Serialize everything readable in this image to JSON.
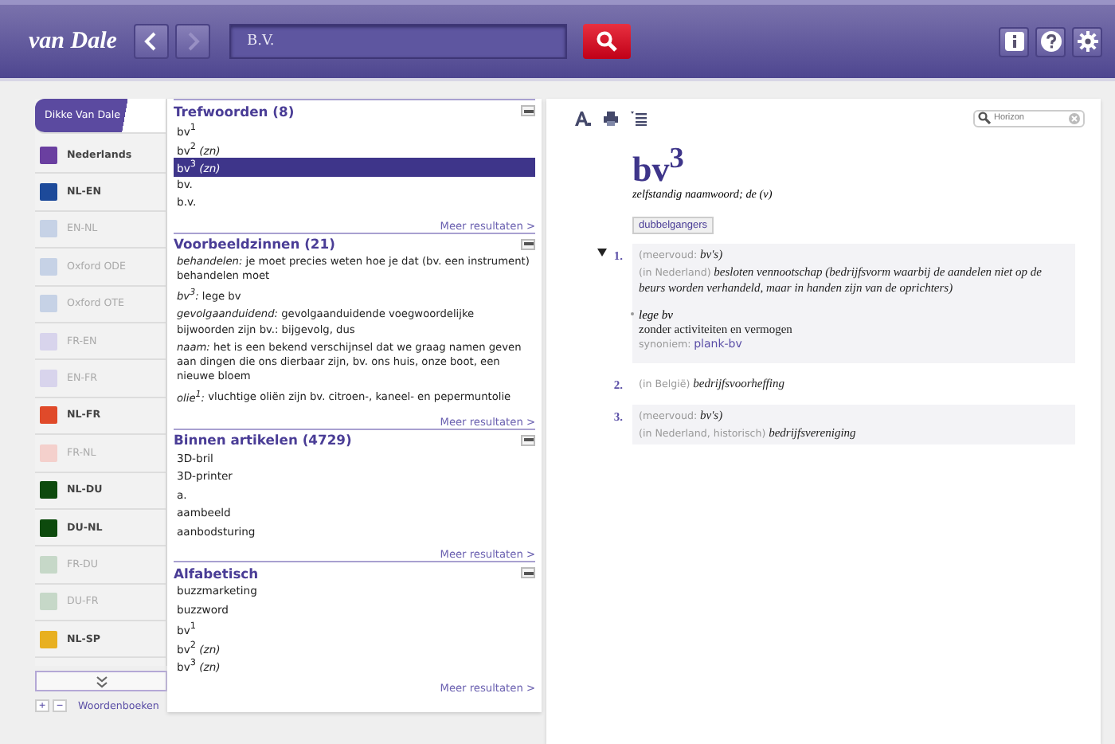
{
  "header": {
    "logo": "van Dale",
    "search": {
      "value": "B.V."
    },
    "back_disabled": false,
    "forward_disabled": true
  },
  "dictionaries": [
    {
      "label": "Dikke Van Dale",
      "color": "#5b4aa0",
      "available": true,
      "selected": true
    },
    {
      "label": "Nederlands",
      "color": "#6a3fa0",
      "available": true,
      "selected": false
    },
    {
      "label": "NL-EN",
      "color": "#1d4a9a",
      "available": true,
      "selected": false
    },
    {
      "label": "EN-NL",
      "color": "#c6d2e6",
      "available": false,
      "selected": false
    },
    {
      "label": "Oxford ODE",
      "color": "#c6d2e6",
      "available": false,
      "selected": false
    },
    {
      "label": "Oxford OTE",
      "color": "#c6d2e6",
      "available": false,
      "selected": false
    },
    {
      "label": "FR-EN",
      "color": "#d8d4ec",
      "available": false,
      "selected": false
    },
    {
      "label": "EN-FR",
      "color": "#d8d4ec",
      "available": false,
      "selected": false
    },
    {
      "label": "NL-FR",
      "color": "#e04a2a",
      "available": true,
      "selected": false
    },
    {
      "label": "FR-NL",
      "color": "#f4d0cc",
      "available": false,
      "selected": false
    },
    {
      "label": "NL-DU",
      "color": "#0d4a0d",
      "available": true,
      "selected": false
    },
    {
      "label": "DU-NL",
      "color": "#0d4a0d",
      "available": true,
      "selected": false
    },
    {
      "label": "FR-DU",
      "color": "#c6d8c8",
      "available": false,
      "selected": false
    },
    {
      "label": "DU-FR",
      "color": "#c6d8c8",
      "available": false,
      "selected": false
    },
    {
      "label": "NL-SP",
      "color": "#e8b020",
      "available": true,
      "selected": false
    }
  ],
  "sidebar_footer": {
    "add": "+",
    "remove": "−",
    "link": "Woordenboeken"
  },
  "sections": [
    {
      "title": "Trefwoorden (8)",
      "kind": "list",
      "items": [
        {
          "text": "bv$^{1}$",
          "selected": false
        },
        {
          "text": "bv$^{2}$ *(zn)*",
          "selected": false
        },
        {
          "text": "bv$^{3}$ *(zn)*",
          "selected": true
        },
        {
          "text": "bv.",
          "selected": false
        },
        {
          "text": "b.v.",
          "selected": false
        }
      ],
      "more": "Meer resultaten >"
    },
    {
      "title": "Voorbeeldzinnen (21)",
      "kind": "sentences",
      "items": [
        {
          "text": "*behandelen:* je moet precies weten hoe je dat (bv. een instrument) behandelen moet"
        },
        {
          "text": "*bv$^{3}$:* lege bv"
        },
        {
          "text": "*gevolgaanduidend:* gevolgaanduidende voegwoordelijke bijwoorden zijn bv.: bijgevolg, dus"
        },
        {
          "text": "*naam:* het is een bekend verschijnsel dat we graag namen geven aan dingen die ons dierbaar zijn, bv. ons huis, onze boot, een nieuwe bloem"
        },
        {
          "text": "*olie$^{1}$:* vluchtige oliën zijn bv. citroen-, kaneel- en pepermuntolie"
        }
      ],
      "more": "Meer resultaten >"
    },
    {
      "title": "Binnen artikelen (4729)",
      "kind": "list",
      "items": [
        {
          "text": "3D-bril",
          "selected": false
        },
        {
          "text": "3D-printer",
          "selected": false
        },
        {
          "text": "a.",
          "selected": false
        },
        {
          "text": "aambeeld",
          "selected": false
        },
        {
          "text": "aanbodsturing",
          "selected": false
        }
      ],
      "more": "Meer resultaten >"
    },
    {
      "title": "Alfabetisch",
      "kind": "list",
      "items": [
        {
          "text": "buzzmarketing",
          "selected": false
        },
        {
          "text": "buzzword",
          "selected": false
        },
        {
          "text": "bv$^{1}$",
          "selected": false
        },
        {
          "text": "bv$^{2}$ *(zn)*",
          "selected": false
        },
        {
          "text": "bv$^{3}$ *(zn)*",
          "selected": false
        }
      ],
      "more": "Meer resultaten >"
    }
  ],
  "article": {
    "find": {
      "placeholder": "Horizon"
    },
    "headword": "bv$^{3}$",
    "grammar": "zelfstandig naamwoord; de (v)",
    "tag": "dubbelgangers",
    "senses": [
      {
        "number": "1.",
        "expanded": true,
        "lines": [
          {
            "label": "(meervoud:",
            "text": "*bv's)*"
          },
          {
            "label": "(in Nederland)",
            "text": "*besloten vennootschap (bedrijfsvorm waarbij de aandelen niet op de beurs worden verhandeld, maar in handen zijn van de oprichters)*"
          }
        ],
        "sub": {
          "phrase": "lege bv",
          "meaning": "zonder activiteiten en vermogen",
          "label": "synoniem:",
          "link": "plank-bv"
        }
      },
      {
        "number": "2.",
        "lines": [
          {
            "label": "(in België)",
            "text": "*bedrijfsvoorheffing*"
          }
        ]
      },
      {
        "number": "3.",
        "lines": [
          {
            "label": "(meervoud:",
            "text": "*bv's)*"
          },
          {
            "label": "(in Nederland, historisch)",
            "text": "*bedrijfsvereniging*"
          }
        ]
      }
    ]
  }
}
